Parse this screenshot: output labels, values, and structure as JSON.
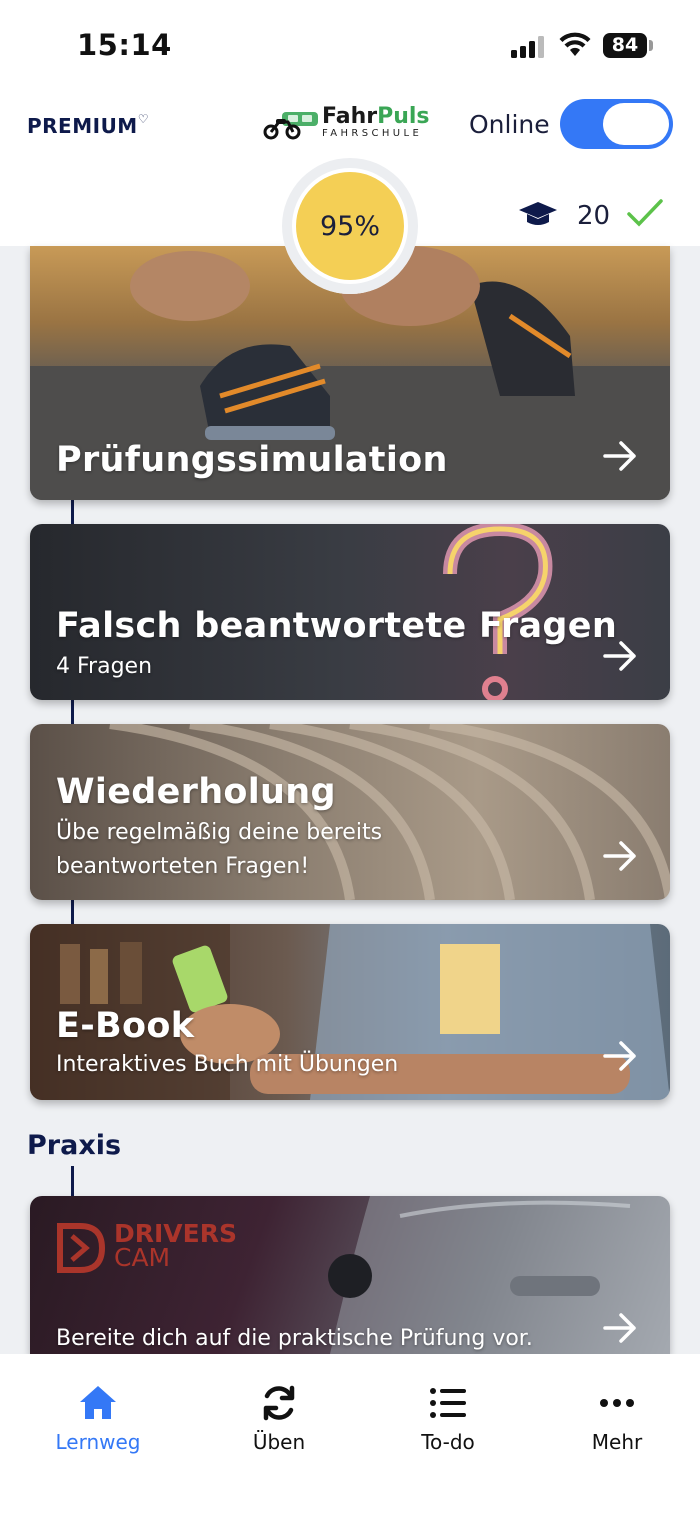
{
  "status_bar": {
    "time": "15:14",
    "battery": "84"
  },
  "header": {
    "membership": "PREMIUM",
    "logo_name_a": "Fahr",
    "logo_name_b": "Puls",
    "logo_sub": "FAHRSCHULE",
    "online_label": "Online",
    "online_enabled": true,
    "progress": "95%",
    "cap_count": "20"
  },
  "cards": [
    {
      "title": "Prüfungssimulation",
      "subtitle": ""
    },
    {
      "title": "Falsch beantwortete Fragen",
      "subtitle": "4 Fragen"
    },
    {
      "title": "Wiederholung",
      "subtitle_line1": "Übe regelmäßig deine bereits",
      "subtitle_line2": "beantworteten Fragen!"
    },
    {
      "title": "E-Book",
      "subtitle": "Interaktives Buch mit Übungen"
    }
  ],
  "praxis": {
    "section_title": "Praxis",
    "brand_line1": "DRIVERS",
    "brand_line2": "CAM",
    "subtitle": "Bereite dich auf die praktische Prüfung vor."
  },
  "nav": [
    {
      "label": "Lernweg",
      "icon": "home-icon",
      "active": true
    },
    {
      "label": "Üben",
      "icon": "sync-icon",
      "active": false
    },
    {
      "label": "To-do",
      "icon": "list-icon",
      "active": false
    },
    {
      "label": "Mehr",
      "icon": "more-icon",
      "active": false
    }
  ],
  "colors": {
    "accent": "#3478f6",
    "navy": "#0e1a4b",
    "progress_fill": "#f4cf55",
    "check": "#5cc24a"
  }
}
